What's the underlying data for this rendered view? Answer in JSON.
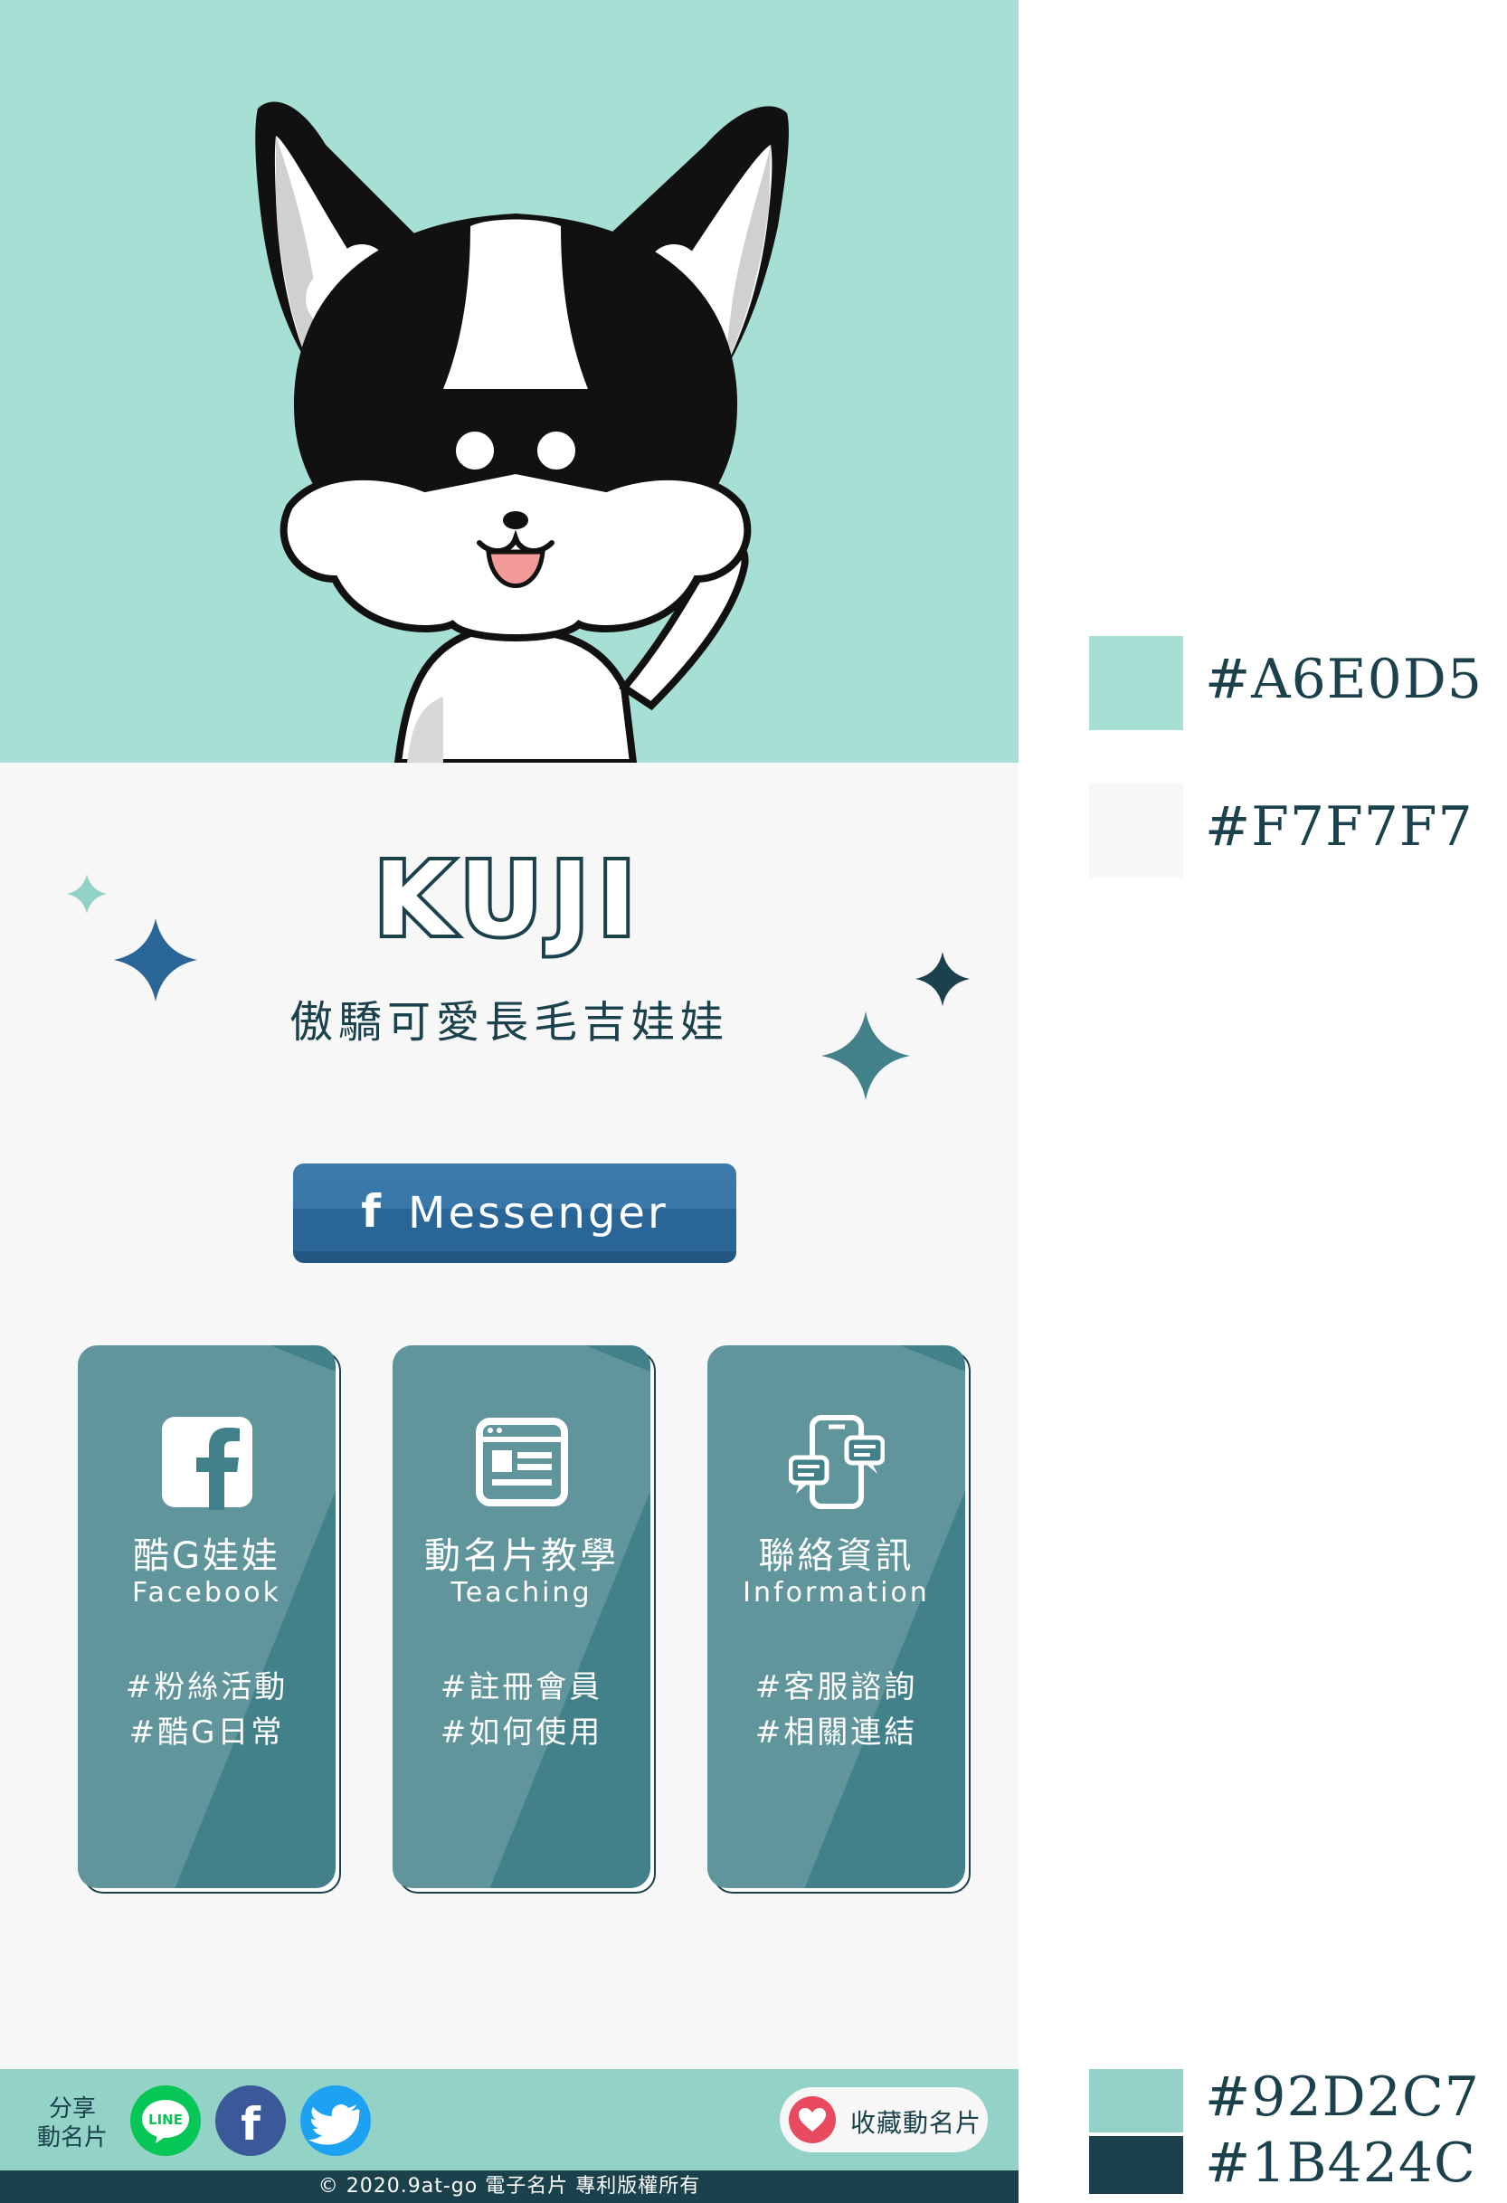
{
  "profile": {
    "title": "KUJI",
    "subtitle": "傲驕可愛長毛吉娃娃"
  },
  "messenger": {
    "label": "Messenger",
    "icon": "facebook-f-icon"
  },
  "tiles": [
    {
      "icon": "facebook-icon",
      "name": "酷G娃娃",
      "en": "Facebook",
      "tags": [
        "#粉絲活動",
        "#酷G日常"
      ]
    },
    {
      "icon": "browser-card-icon",
      "name": "動名片教學",
      "en": "Teaching",
      "tags": [
        "#註冊會員",
        "#如何使用"
      ]
    },
    {
      "icon": "phone-chat-icon",
      "name": "聯絡資訊",
      "en": "Information",
      "tags": [
        "#客服諮詢",
        "#相關連結"
      ]
    }
  ],
  "footer": {
    "share_label_line1": "分享",
    "share_label_line2": "動名片",
    "share_buttons": [
      {
        "icon": "line-icon",
        "text": "LINE",
        "color": "#06C755"
      },
      {
        "icon": "facebook-icon",
        "text": "f",
        "color": "#3B5998"
      },
      {
        "icon": "twitter-icon",
        "color": "#1DA1F2"
      }
    ],
    "save_label": "收藏動名片",
    "copyright": "© 2020.9at-go 電子名片 專利版權所有"
  },
  "palette": [
    {
      "hex": "#A6E0D5"
    },
    {
      "hex": "#F7F7F7"
    },
    {
      "hex": "#92D2C7"
    },
    {
      "hex": "#1B424C"
    }
  ],
  "colors": {
    "hero_bg": "#A6E0D5",
    "card_bg": "#F7F7F7",
    "footer_bg": "#92D2C7",
    "dark": "#1B424C",
    "tile": "#42818A",
    "messenger": "#2A6597"
  }
}
